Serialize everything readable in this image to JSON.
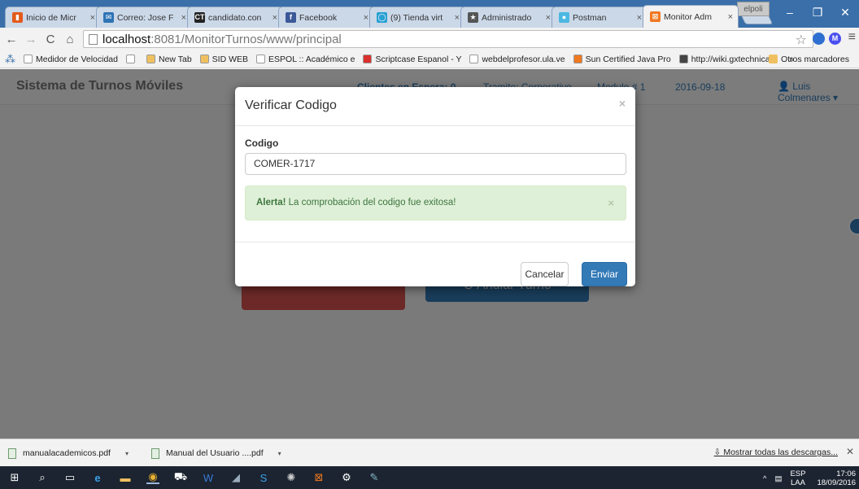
{
  "browser": {
    "tabs": [
      {
        "title": "Inicio de Micr",
        "color": "#e35b1b",
        "glyph": "▮"
      },
      {
        "title": "Correo: Jose F",
        "color": "#2e74b5",
        "glyph": "✉"
      },
      {
        "title": "candidato.con",
        "color": "#222222",
        "glyph": "CT"
      },
      {
        "title": "Facebook",
        "color": "#3b5998",
        "glyph": "f"
      },
      {
        "title": "(9) Tienda virt",
        "color": "#2aa1d3",
        "glyph": "◯"
      },
      {
        "title": "Administrado",
        "color": "#555555",
        "glyph": "★"
      },
      {
        "title": "Postman",
        "color": "#4bb8e2",
        "glyph": "●"
      },
      {
        "title": "Monitor Adm",
        "color": "#f07820",
        "glyph": "⊠"
      }
    ],
    "profile": "elpoli",
    "url_host": "localhost",
    "url_path": ":8081/MonitorTurnos/www/principal",
    "bookmarks": [
      {
        "label": "Medidor de Velocidad",
        "color": "#ffffff"
      },
      {
        "label": "",
        "color": "#ffffff"
      },
      {
        "label": "New Tab",
        "color": "#f0c060"
      },
      {
        "label": "SID WEB",
        "color": "#f0c060"
      },
      {
        "label": "ESPOL :: Académico e",
        "color": "#ffffff"
      },
      {
        "label": "Scriptcase Espanol - Y",
        "color": "#d9302c"
      },
      {
        "label": "webdelprofesor.ula.ve",
        "color": "#ffffff"
      },
      {
        "label": "Sun Certified Java Pro",
        "color": "#f07820"
      },
      {
        "label": "http://wiki.gxtechnical",
        "color": "#444444"
      }
    ],
    "more_label": "»",
    "otros_label": "Otros marcadores"
  },
  "app": {
    "brand": "Sistema de Turnos Móviles",
    "clientes": "Clientes en Espera: 0",
    "tramite": "Tramite: Corporativo",
    "modulo": "Modulo # 1",
    "fecha": "2016-09-18",
    "user": "Luis Colmenares",
    "anular_label": "Anular Turno"
  },
  "modal": {
    "title": "Verificar Codigo",
    "field_label": "Codigo",
    "field_value": "COMER-1717",
    "alert_strong": "Alerta!",
    "alert_text": " La comprobación del codigo fue exitosa!",
    "cancel_label": "Cancelar",
    "send_label": "Enviar"
  },
  "downloads": {
    "items": [
      "manualacademicos.pdf",
      "Manual del Usuario ....pdf"
    ],
    "show_all": "Mostrar todas las descargas..."
  },
  "taskbar": {
    "lang_top": "ESP",
    "lang_bottom": "LAA",
    "time": "17:06",
    "date": "18/09/2016"
  }
}
